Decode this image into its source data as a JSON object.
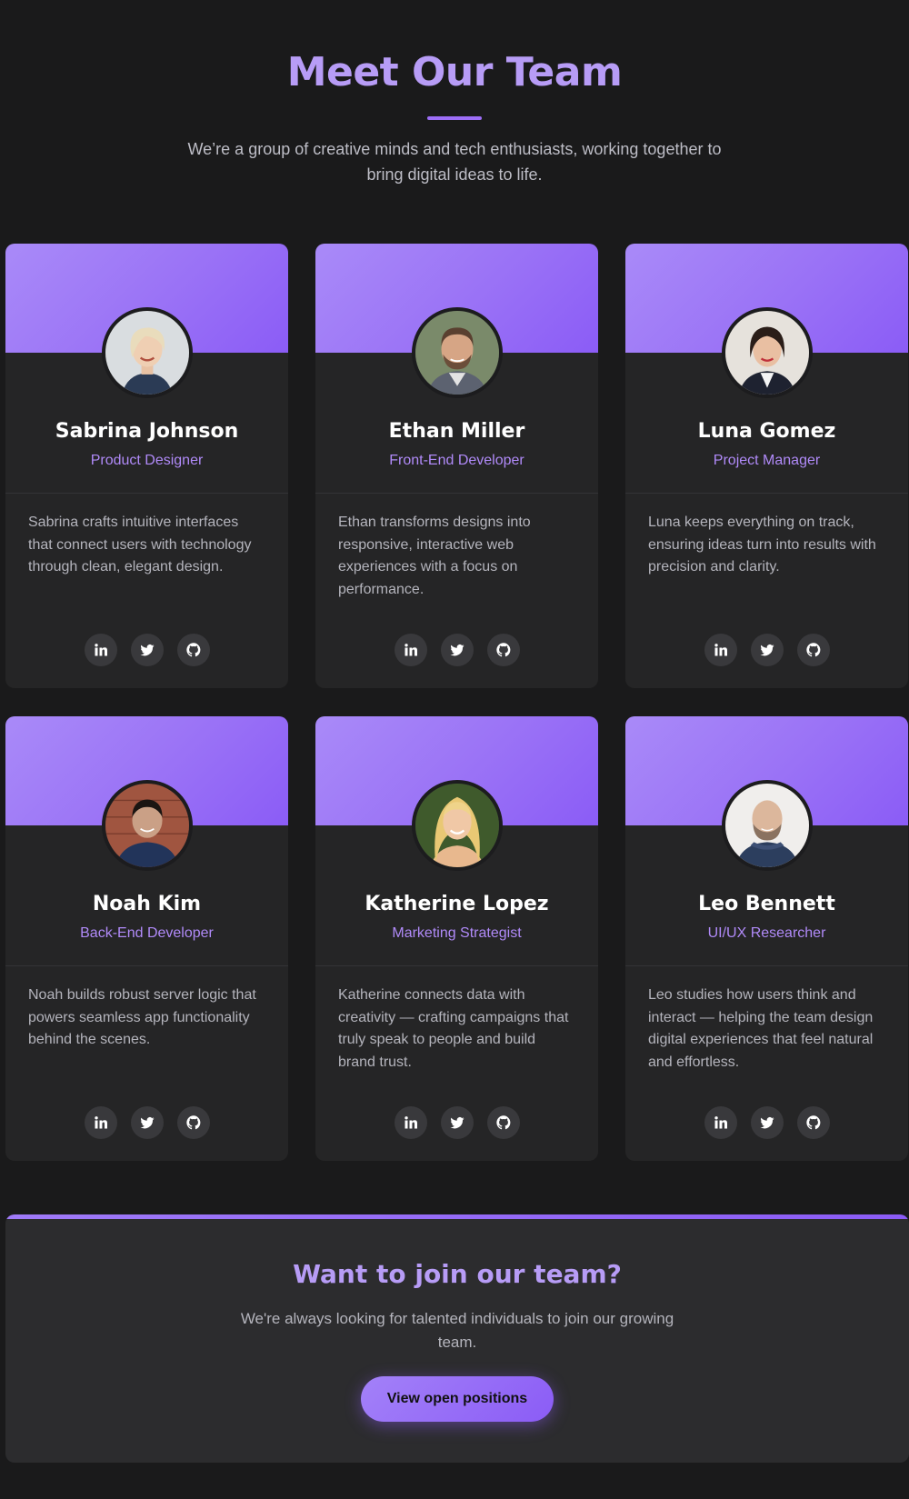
{
  "header": {
    "title": "Meet Our Team",
    "subtitle": "We’re a group of creative minds and tech enthusiasts, working together to bring digital ideas to life."
  },
  "members": [
    {
      "name": "Sabrina Johnson",
      "role": "Product Designer",
      "bio": "Sabrina crafts intuitive interfaces that connect users with technology through clean, elegant design.",
      "photo": "woman-short-blonde-hair"
    },
    {
      "name": "Ethan Miller",
      "role": "Front-End Developer",
      "bio": "Ethan transforms designs into responsive, interactive web experiences with a focus on performance.",
      "photo": "man-brown-hair-beard"
    },
    {
      "name": "Luna Gomez",
      "role": "Project Manager",
      "bio": "Luna keeps everything on track, ensuring ideas turn into results with precision and clarity.",
      "photo": "woman-dark-hair"
    },
    {
      "name": "Noah Kim",
      "role": "Back-End Developer",
      "bio": "Noah builds robust server logic that powers seamless app functionality behind the scenes.",
      "photo": "man-dark-hair-brick-wall"
    },
    {
      "name": "Katherine Lopez",
      "role": "Marketing Strategist",
      "bio": "Katherine connects data with creativity — crafting campaigns that truly speak to people and build brand trust.",
      "photo": "woman-long-blonde-hair"
    },
    {
      "name": "Leo Bennett",
      "role": "UI/UX Researcher",
      "bio": "Leo studies how users think and interact — helping the team design digital experiences that feel natural and effortless.",
      "photo": "man-bald-beard"
    }
  ],
  "social_icons": [
    "linkedin-icon",
    "twitter-icon",
    "github-icon"
  ],
  "cta": {
    "title": "Want to join our team?",
    "text": "We're always looking for talented individuals to join our growing team.",
    "button_label": "View open positions"
  },
  "colors": {
    "background": "#1a1a1b",
    "card": "#252526",
    "accent": "#8b5cf6",
    "accent_light": "#b79cf6",
    "role_text": "#b08af8"
  }
}
